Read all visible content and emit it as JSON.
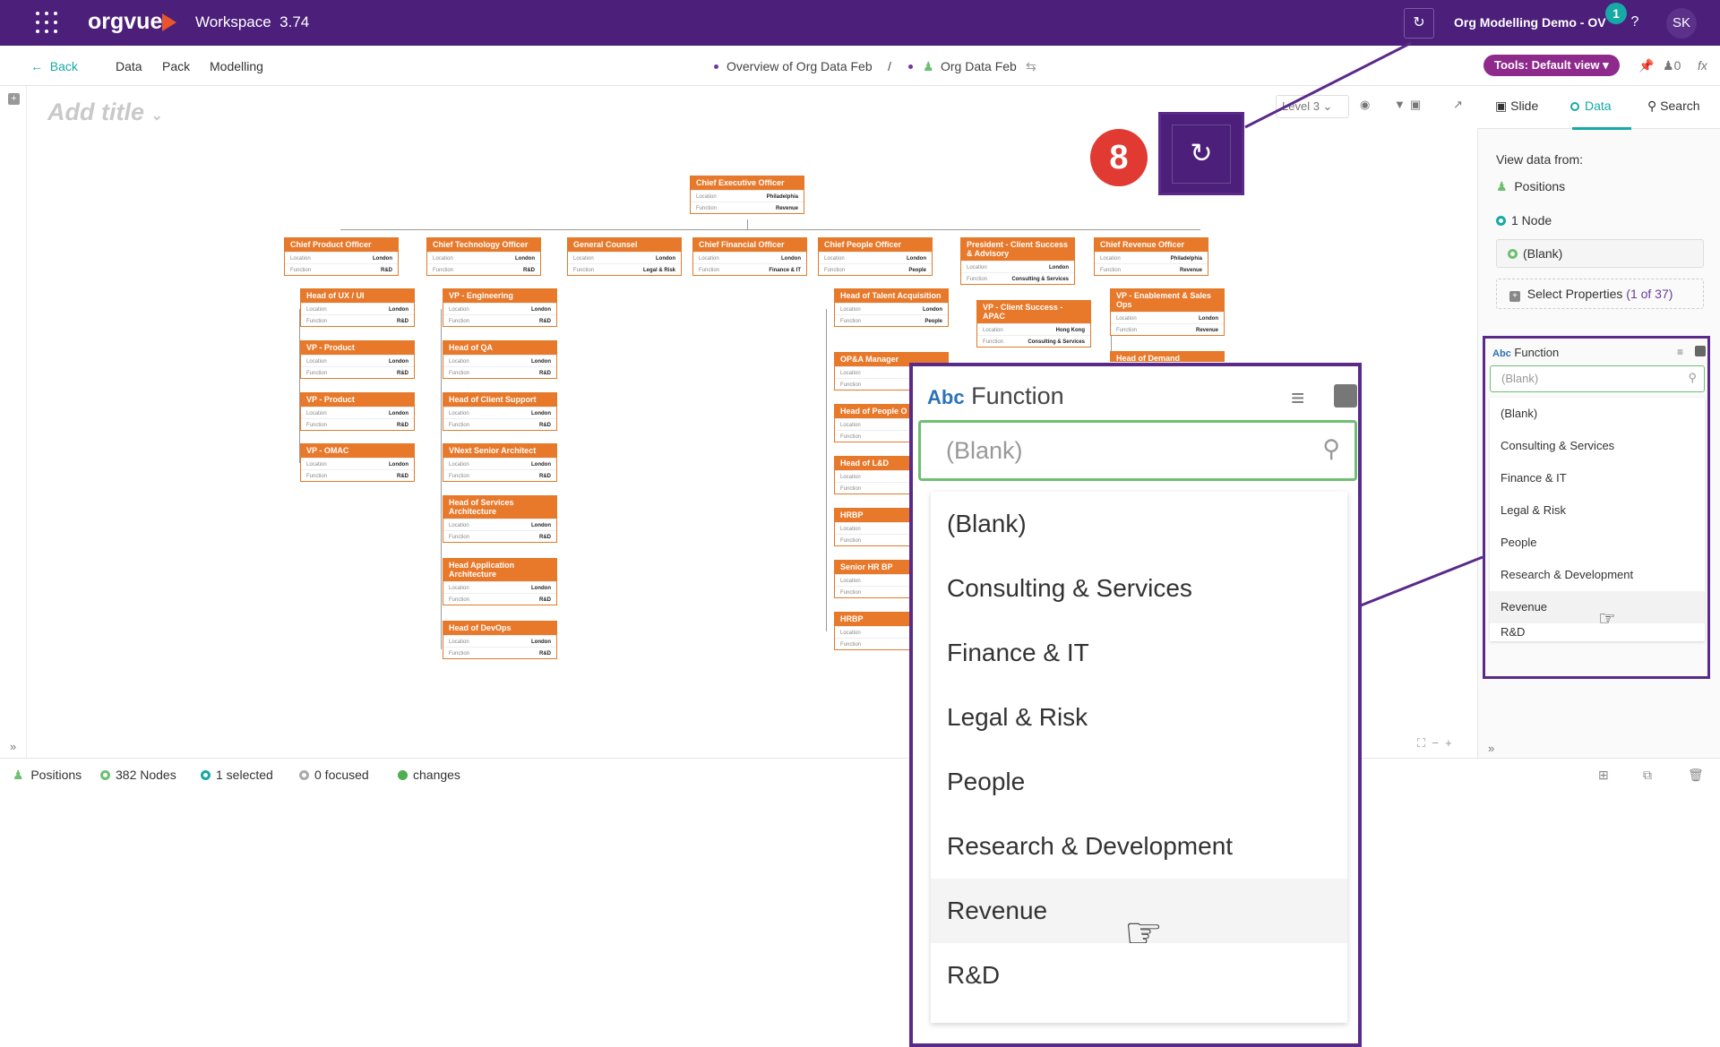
{
  "topbar": {
    "logo": "orgvue",
    "workspace": "Workspace",
    "version": "3.74",
    "project": "Org Modelling Demo - OV",
    "badge": "1",
    "help": "?",
    "avatar": "SK",
    "brand_color": "#4b1f7a"
  },
  "subbar": {
    "back": "Back",
    "nav": [
      "Data",
      "Pack",
      "Modelling"
    ],
    "crumb1": "Overview of Org Data Feb",
    "separator": "/",
    "crumb2": "Org Data Feb",
    "tools": "Tools: Default view",
    "counter": "0",
    "fx": "fx"
  },
  "canvas": {
    "add_title": "Add title",
    "level": "Level 3"
  },
  "callout": {
    "number": "8"
  },
  "orgchart": {
    "field_location": "Location",
    "field_function": "Function",
    "nodes": [
      {
        "title": "Chief Executive Officer",
        "location": "Philadelphia",
        "function": "Revenue"
      },
      {
        "title": "Chief Product Officer",
        "location": "London",
        "function": "R&D"
      },
      {
        "title": "Chief Technology Officer",
        "location": "London",
        "function": "R&D"
      },
      {
        "title": "General Counsel",
        "location": "London",
        "function": "Legal & Risk"
      },
      {
        "title": "Chief Financial Officer",
        "location": "London",
        "function": "Finance & IT"
      },
      {
        "title": "Chief People Officer",
        "location": "London",
        "function": "People"
      },
      {
        "title": "President - Client Success & Advisory",
        "location": "London",
        "function": "Consulting & Services"
      },
      {
        "title": "Chief Revenue Officer",
        "location": "Philadelphia",
        "function": "Revenue"
      },
      {
        "title": "Head of UX / UI",
        "location": "London",
        "function": "R&D"
      },
      {
        "title": "VP - Product",
        "location": "London",
        "function": "R&D"
      },
      {
        "title": "VP - Product",
        "location": "London",
        "function": "R&D"
      },
      {
        "title": "VP - OMAC",
        "location": "London",
        "function": "R&D"
      },
      {
        "title": "VP - Engineering",
        "location": "London",
        "function": "R&D"
      },
      {
        "title": "Head of QA",
        "location": "London",
        "function": "R&D"
      },
      {
        "title": "Head of Client Support",
        "location": "London",
        "function": "R&D"
      },
      {
        "title": "VNext Senior Architect",
        "location": "London",
        "function": "R&D"
      },
      {
        "title": "Head of Services Architecture",
        "location": "London",
        "function": "R&D"
      },
      {
        "title": "Head Application Architecture",
        "location": "London",
        "function": "R&D"
      },
      {
        "title": "Head of DevOps",
        "location": "London",
        "function": "R&D"
      },
      {
        "title": "Head of Talent Acquisition",
        "location": "London",
        "function": "People"
      },
      {
        "title": "OP&A Manager",
        "location": "",
        "function": ""
      },
      {
        "title": "Head of People O",
        "location": "",
        "function": ""
      },
      {
        "title": "Head of L&D",
        "location": "",
        "function": ""
      },
      {
        "title": "HRBP",
        "location": "",
        "function": ""
      },
      {
        "title": "Senior HR BP",
        "location": "",
        "function": ""
      },
      {
        "title": "HRBP",
        "location": "",
        "function": ""
      },
      {
        "title": "VP - Client Success - APAC",
        "location": "Hong Kong",
        "function": "Consulting & Services"
      },
      {
        "title": "VP - Enablement & Sales Ops",
        "location": "London",
        "function": "Revenue"
      },
      {
        "title": "Head of Demand",
        "location": "",
        "function": ""
      }
    ]
  },
  "rightpanel": {
    "tabs": [
      "Slide",
      "Data",
      "Search"
    ],
    "view_from": "View data from:",
    "positions": "Positions",
    "node_count": "1 Node",
    "blank": "(Blank)",
    "select_props": "Select Properties",
    "select_count": "(1 of 37)"
  },
  "function_filter": {
    "type": "Abc",
    "label": "Function",
    "search_value": "(Blank)",
    "options": [
      "(Blank)",
      "Consulting & Services",
      "Finance & IT",
      "Legal & Risk",
      "People",
      "Research & Development",
      "Revenue",
      "R&D"
    ],
    "hovered": "Revenue"
  },
  "status": {
    "positions": "Positions",
    "nodes": "382 Nodes",
    "selected": "1 selected",
    "focused": "0 focused",
    "changes": "changes",
    "accent": "#17a9a6"
  }
}
